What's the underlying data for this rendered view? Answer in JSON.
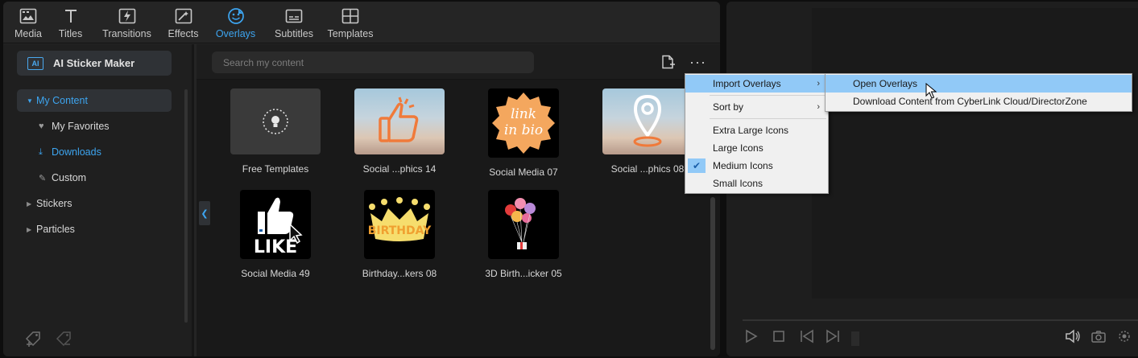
{
  "rooms": [
    {
      "label": "Media",
      "icon": "media-icon",
      "active": false
    },
    {
      "label": "Titles",
      "icon": "titles-icon",
      "active": false
    },
    {
      "label": "Transitions",
      "icon": "transitions-icon",
      "active": false
    },
    {
      "label": "Effects",
      "icon": "effects-icon",
      "active": false
    },
    {
      "label": "Overlays",
      "icon": "overlays-icon",
      "active": true
    },
    {
      "label": "Subtitles",
      "icon": "subtitles-icon",
      "active": false
    },
    {
      "label": "Templates",
      "icon": "templates-icon",
      "active": false
    }
  ],
  "sidebar": {
    "ai_button": "AI Sticker Maker",
    "ai_icon_text": "AI",
    "tree": {
      "my_content": "My Content",
      "my_favorites": "My Favorites",
      "downloads": "Downloads",
      "custom": "Custom",
      "stickers": "Stickers",
      "particles": "Particles"
    }
  },
  "search": {
    "placeholder": "Search my content"
  },
  "items": [
    {
      "caption": "Free Templates"
    },
    {
      "caption": "Social ...phics 14"
    },
    {
      "caption": "Social Media 07"
    },
    {
      "caption": "Social ...phics 08"
    },
    {
      "caption": "Social Media 49"
    },
    {
      "caption": "Birthday...kers 08"
    },
    {
      "caption": "3D Birth...icker 05"
    }
  ],
  "thumb_text": {
    "link_in_bio": "link in bio",
    "like": "LIKE",
    "birthday": "BIRTHDAY"
  },
  "menu_main": {
    "import_overlays": "Import Overlays",
    "sort_by": "Sort by",
    "extra_large": "Extra Large Icons",
    "large": "Large Icons",
    "medium": "Medium Icons",
    "small": "Small Icons",
    "checked": "Medium Icons"
  },
  "menu_sub": {
    "open_overlays": "Open Overlays",
    "download_content": "Download Content from CyberLink Cloud/DirectorZone"
  },
  "colors": {
    "accent": "#3da5f0",
    "menu_highlight": "#91c9f7"
  }
}
